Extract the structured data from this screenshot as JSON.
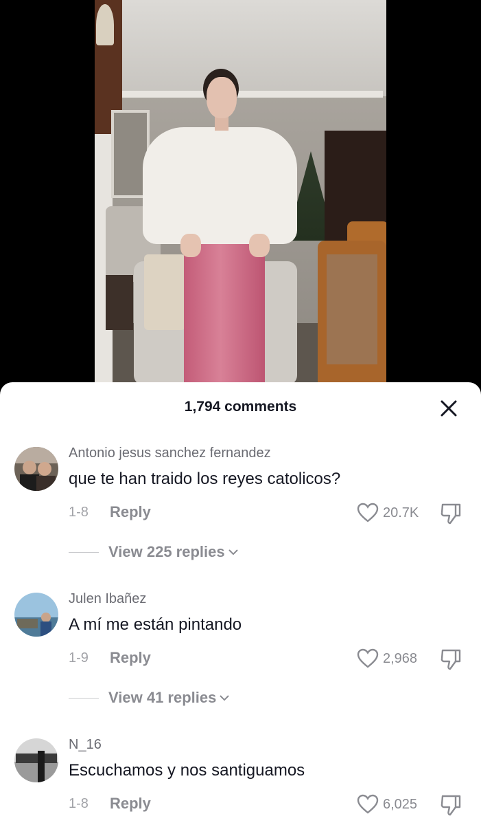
{
  "video": {
    "description_icon": "video-frame"
  },
  "comments_panel": {
    "title": "1,794 comments",
    "close_icon": "close-icon"
  },
  "comments": [
    {
      "username": "Antonio jesus sanchez fernandez",
      "text": "que te han traido los reyes catolicos?",
      "date": "1-8",
      "reply_label": "Reply",
      "likes": "20.7K",
      "view_replies": "View 225 replies"
    },
    {
      "username": "Julen Ibañez",
      "text": "A mí me están pintando",
      "date": "1-9",
      "reply_label": "Reply",
      "likes": "2,968",
      "view_replies": "View 41 replies"
    },
    {
      "username": "N_16",
      "text": "Escuchamos y nos santiguamos",
      "date": "1-8",
      "reply_label": "Reply",
      "likes": "6,025"
    }
  ],
  "colors": {
    "text_primary": "#161823",
    "text_secondary": "#8a8b91",
    "background": "#ffffff",
    "video_bg": "#000000"
  }
}
